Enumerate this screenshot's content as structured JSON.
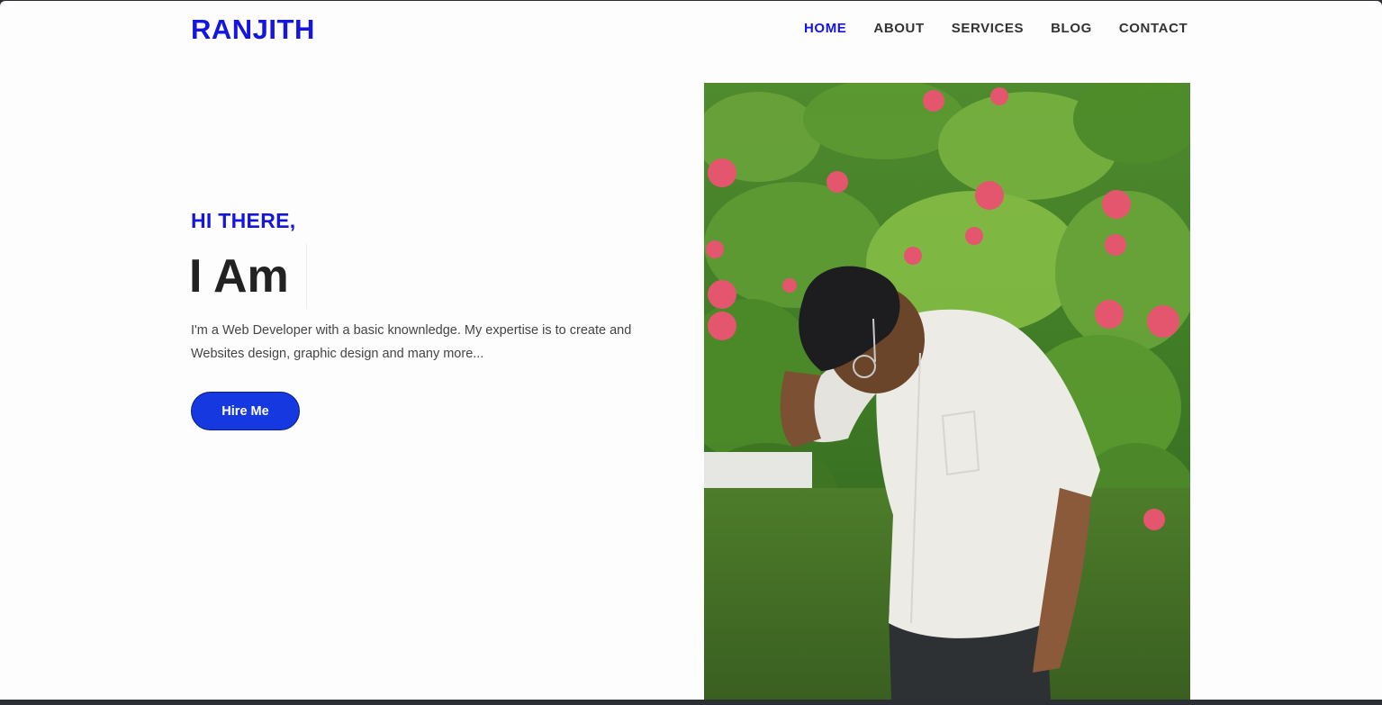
{
  "brand": {
    "name": "RANJITH"
  },
  "nav": {
    "items": [
      {
        "label": "HOME",
        "active": true
      },
      {
        "label": "ABOUT",
        "active": false
      },
      {
        "label": "SERVICES",
        "active": false
      },
      {
        "label": "BLOG",
        "active": false
      },
      {
        "label": "CONTACT",
        "active": false
      }
    ]
  },
  "hero": {
    "greeting": "HI THERE,",
    "title": "I Am",
    "description_line1": "I'm a Web Developer with a basic knownledge. My expertise is to create and",
    "description_line2": "Websites design, graphic design and many more...",
    "cta_label": "Hire Me"
  },
  "colors": {
    "accent": "#1515e0",
    "button": "#1538e0",
    "text_dark": "#222222",
    "text_body": "#444444"
  }
}
